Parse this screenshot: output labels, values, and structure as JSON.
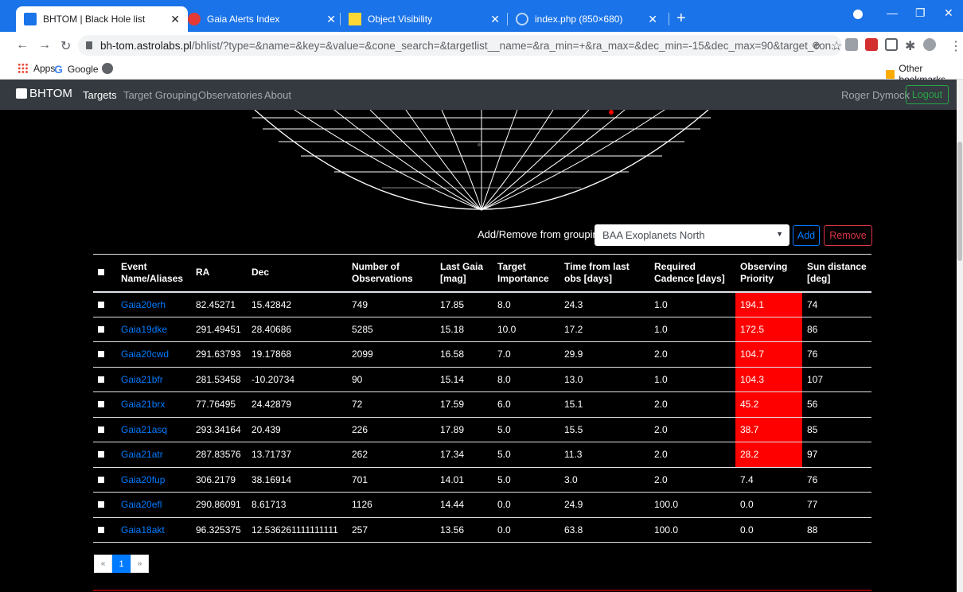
{
  "browser": {
    "tabs": [
      {
        "title": "BHTOM | Black Hole list"
      },
      {
        "title": "Gaia Alerts Index"
      },
      {
        "title": "Object Visibility"
      },
      {
        "title": "index.php (850×680)"
      }
    ],
    "url_host": "bh-tom.astrolabs.pl",
    "url_rest": "/bhlist/?type=&name=&key=&value=&cone_search=&targetlist__name=&ra_min=+&ra_max=&dec_min=-15&dec_max=90&target_con...",
    "bookmarks": {
      "apps": "Apps",
      "google": "Google",
      "other": "Other bookmarks"
    }
  },
  "nav": {
    "brand": "BHTOM",
    "links": [
      "Targets",
      "Target Grouping",
      "Observatories",
      "About"
    ],
    "user": "Roger Dymock",
    "logout": "Logout"
  },
  "grouping": {
    "label": "Add/Remove from grouping",
    "selected": "BAA Exoplanets North",
    "add": "Add",
    "remove": "Remove"
  },
  "table": {
    "headers": [
      "",
      "Event Name/Aliases",
      "RA",
      "Dec",
      "Number of Observations",
      "Last Gaia [mag]",
      "Target Importance",
      "Time from last obs [days]",
      "Required Cadence [days]",
      "Observing Priority",
      "Sun distance [deg]"
    ],
    "rows": [
      [
        "Gaia20erh",
        "82.45271",
        "15.42842",
        "749",
        "17.85",
        "8.0",
        "24.3",
        "1.0",
        "194.1",
        "74"
      ],
      [
        "Gaia19dke",
        "291.49451",
        "28.40686",
        "5285",
        "15.18",
        "10.0",
        "17.2",
        "1.0",
        "172.5",
        "86"
      ],
      [
        "Gaia20cwd",
        "291.63793",
        "19.17868",
        "2099",
        "16.58",
        "7.0",
        "29.9",
        "2.0",
        "104.7",
        "76"
      ],
      [
        "Gaia21bfr",
        "281.53458",
        "-10.20734",
        "90",
        "15.14",
        "8.0",
        "13.0",
        "1.0",
        "104.3",
        "107"
      ],
      [
        "Gaia21brx",
        "77.76495",
        "24.42879",
        "72",
        "17.59",
        "6.0",
        "15.1",
        "2.0",
        "45.2",
        "56"
      ],
      [
        "Gaia21asq",
        "293.34164",
        "20.439",
        "226",
        "17.89",
        "5.0",
        "15.5",
        "2.0",
        "38.7",
        "85"
      ],
      [
        "Gaia21atr",
        "287.83576",
        "13.71737",
        "262",
        "17.34",
        "5.0",
        "11.3",
        "2.0",
        "28.2",
        "97"
      ],
      [
        "Gaia20fup",
        "306.2179",
        "38.16914",
        "701",
        "14.01",
        "5.0",
        "3.0",
        "2.0",
        "7.4",
        "76"
      ],
      [
        "Gaia20efl",
        "290.86091",
        "8.61713",
        "1126",
        "14.44",
        "0.0",
        "24.9",
        "100.0",
        "0.0",
        "77"
      ],
      [
        "Gaia18akt",
        "96.325375",
        "12.536261111111111",
        "257",
        "13.56",
        "0.0",
        "63.8",
        "100.0",
        "0.0",
        "88"
      ]
    ],
    "highlight_rows": 7,
    "highlight_color": "#ff0000"
  },
  "pagination": {
    "prev": "«",
    "current": "1",
    "next": "»"
  }
}
